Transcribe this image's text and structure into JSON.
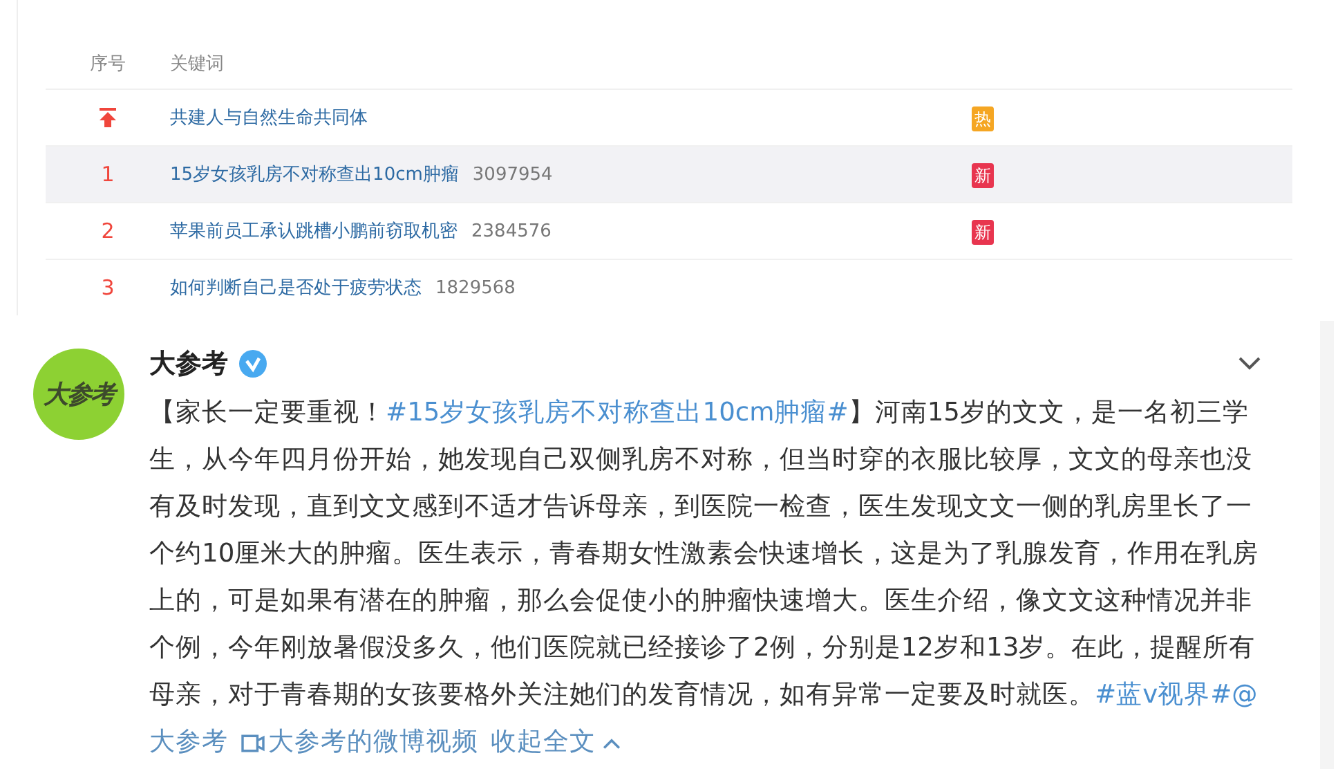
{
  "table": {
    "columns": [
      "序号",
      "关键词"
    ],
    "rows": [
      {
        "kind": "pin",
        "keyword": "共建人与自然生命共同体",
        "badge": {
          "text": "热",
          "color": "#f5a623"
        },
        "selected": false
      },
      {
        "kind": "number",
        "rank": "1",
        "keyword": "15岁女孩乳房不对称查出10cm肿瘤",
        "count": "3097954",
        "badge": {
          "text": "新",
          "color": "#e8354f"
        },
        "selected": true
      },
      {
        "kind": "number",
        "rank": "2",
        "keyword": "苹果前员工承认跳槽小鹏前窃取机密",
        "count": "2384576",
        "badge": {
          "text": "新",
          "color": "#e8354f"
        },
        "selected": false
      },
      {
        "kind": "number",
        "rank": "3",
        "keyword": "如何判断自己是否处于疲劳状态",
        "count": "1829568",
        "selected": false
      }
    ]
  },
  "post": {
    "avatar_text": "大参考",
    "author": "大参考",
    "verified": true,
    "body": [
      {
        "kind": "text",
        "text": "【家长一定要重视！"
      },
      {
        "kind": "link",
        "text": "#15岁女孩乳房不对称查出10cm肿瘤#"
      },
      {
        "kind": "text",
        "text": "】河南15岁的文文，是一名初三学生，从今年四月份开始，她发现自己双侧乳房不对称，但当时穿的衣服比较厚，文文的母亲也没有及时发现，直到文文感到不适才告诉母亲，到医院一检查，医生发现文文一侧的乳房里长了一个约10厘米大的肿瘤。医生表示，青春期女性激素会快速增长，这是为了乳腺发育，作用在乳房上的，可是如果有潜在的肿瘤，那么会促使小的肿瘤快速增大。医生介绍，像文文这种情况并非个例，今年刚放暑假没多久，他们医院就已经接诊了2例，分别是12岁和13岁。在此，提醒所有母亲，对于青春期的女孩要格外关注她们的发育情况，如有异常一定要及时就医。"
      },
      {
        "kind": "link",
        "text": "#蓝v视界#"
      },
      {
        "kind": "link",
        "text": "@"
      }
    ],
    "footer": [
      {
        "kind": "mention",
        "text": "大参考"
      },
      {
        "kind": "video",
        "text": "大参考的微博视频"
      },
      {
        "kind": "collapse",
        "text": "收起全文"
      }
    ]
  }
}
